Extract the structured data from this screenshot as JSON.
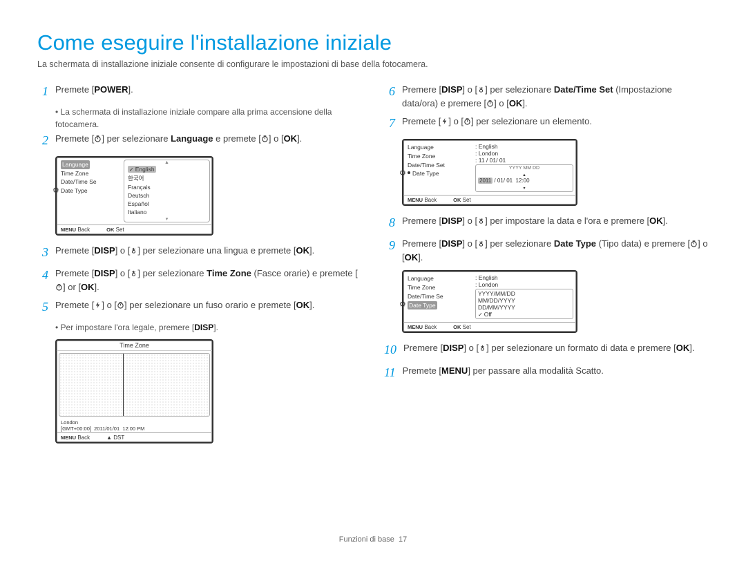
{
  "title": "Come eseguire l'installazione iniziale",
  "subtitle": "La schermata di installazione iniziale consente di configurare le impostazioni di base della fotocamera.",
  "buttons": {
    "power": "POWER",
    "disp": "DISP",
    "ok": "OK",
    "menu": "MENU"
  },
  "shared": {
    "lang_bold": "Language",
    "tz_bold": "Time Zone",
    "dts_bold": "Date/Time Set",
    "dtt_bold": "Date Type"
  },
  "left": {
    "s1": {
      "a": "Premete [",
      "b": "]."
    },
    "s1_bullet": "La schermata di installazione iniziale compare alla prima accensione della fotocamera.",
    "s2": {
      "a": "Premete [",
      "b": "] per selezionare ",
      "c": " e premete [",
      "d": "] o [",
      "e": "]."
    },
    "s3": {
      "a": "Premete [",
      "b": "] o [",
      "c": "] per selezionare una lingua e premete [",
      "d": "]."
    },
    "s4": {
      "a": "Premete [",
      "b": "] o [",
      "c": "] per selezionare ",
      "d": " (Fasce orarie) e premete [",
      "e": "] or [",
      "f": "]."
    },
    "s5": {
      "a": "Premete [",
      "b": "] o [",
      "c": "] per selezionare un fuso orario e premete [",
      "d": "]."
    },
    "s5_bullet": {
      "a": "Per impostare l'ora legale, premere [",
      "b": "]."
    }
  },
  "right": {
    "s6": {
      "a": "Premere [",
      "b": "] o [",
      "c": "] per selezionare ",
      "d": " (Impostazione data/ora) e premere [",
      "e": "] o [",
      "f": "]."
    },
    "s7": {
      "a": "Premete [",
      "b": "] o [",
      "c": "] per selezionare un elemento."
    },
    "s8": {
      "a": "Premere [",
      "b": "] o [",
      "c": "] per impostare la data e l'ora e premere [",
      "d": "]."
    },
    "s9": {
      "a": "Premere [",
      "b": "] o [",
      "c": "] per selezionare ",
      "d": " (Tipo data) e premere [",
      "e": "] o [",
      "f": "]."
    },
    "s10": {
      "a": "Premere [",
      "b": "] o [",
      "c": "] per selezionare un formato di data e premere [",
      "d": "]."
    },
    "s11": {
      "a": "Premete [",
      "b": "] per passare alla modalità Scatto."
    }
  },
  "shot1": {
    "labels": [
      "Language",
      "Time Zone",
      "Date/Time Se",
      "Date Type"
    ],
    "options": [
      "English",
      "한국어",
      "Français",
      "Deutsch",
      "Español",
      "Italiano"
    ],
    "footer_back": "Back",
    "footer_set": "Set",
    "footer_menu": "MENU",
    "footer_ok": "OK"
  },
  "shot2": {
    "title": "Time Zone",
    "city": "London",
    "gmt": "[GMT+00:00]",
    "date": "2011/01/01",
    "time": "12:00 PM",
    "footer_back": "Back",
    "footer_dst": "DST",
    "footer_menu": "MENU"
  },
  "shot3": {
    "labels": [
      "Language",
      "Time Zone",
      "Date/Time Set",
      "Date Type"
    ],
    "values": [
      "English",
      "London",
      "11 / 01/ 01"
    ],
    "dt_row1": "YYYY MM DD",
    "dt_row2": "2011 / 01/ 01  12:00",
    "footer_back": "Back",
    "footer_set": "Set",
    "footer_menu": "MENU",
    "footer_ok": "OK"
  },
  "shot4": {
    "labels": [
      "Language",
      "Time Zone",
      "Date/Time Se",
      "Date Type"
    ],
    "values": [
      "English",
      "London"
    ],
    "options": [
      "YYYY/MM/DD",
      "MM/DD/YYYY",
      "DD/MM/YYYY",
      "Off"
    ],
    "footer_back": "Back",
    "footer_set": "Set",
    "footer_menu": "MENU",
    "footer_ok": "OK"
  },
  "footer": {
    "section": "Funzioni di base",
    "page": "17"
  }
}
